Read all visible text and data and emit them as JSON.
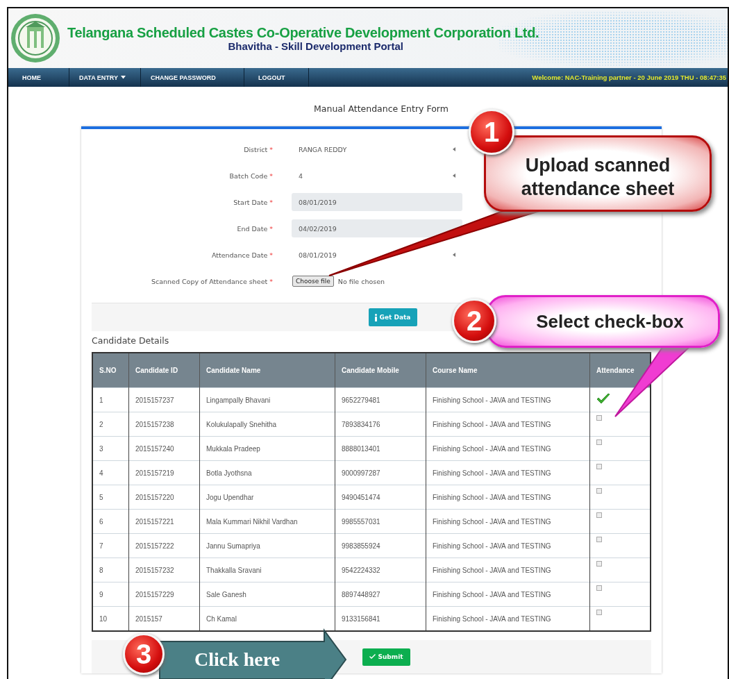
{
  "header": {
    "title": "Telangana Scheduled Castes Co-Operative Development Corporation Ltd.",
    "subtitle": "Bhavitha - Skill Development Portal"
  },
  "nav": {
    "items": [
      {
        "label": "HOME",
        "dropdown": false
      },
      {
        "label": "DATA ENTRY",
        "dropdown": true
      },
      {
        "label": "CHANGE PASSWORD",
        "dropdown": false
      },
      {
        "label": "LOGOUT",
        "dropdown": false
      }
    ],
    "welcome": "Welcome: NAC-Training partner - 20 June 2019 THU - 08:47:35"
  },
  "form": {
    "title": "Manual Attendance Entry Form",
    "fields": [
      {
        "kind": "select",
        "label": "District",
        "required_mark": "*",
        "value": "RANGA REDDY"
      },
      {
        "kind": "select",
        "label": "Batch Code",
        "required_mark": "*",
        "value": "4"
      },
      {
        "kind": "readonly",
        "label": "Start Date",
        "required_mark": "*",
        "value": "08/01/2019"
      },
      {
        "kind": "readonly",
        "label": "End Date",
        "required_mark": "*",
        "value": "04/02/2019"
      },
      {
        "kind": "select",
        "label": "Attendance Date",
        "required_mark": "*",
        "value": "08/01/2019"
      },
      {
        "kind": "file",
        "label": "Scanned Copy of Attendance sheet",
        "required_mark": "*",
        "button": "Choose file",
        "value": "No file chosen"
      }
    ],
    "get_data_button": "Get Data"
  },
  "candidates": {
    "title": "Candidate Details",
    "columns": [
      "S.NO",
      "Candidate ID",
      "Candidate Name",
      "Candidate Mobile",
      "Course Name",
      "Attendance"
    ],
    "rows": [
      {
        "cells": [
          "1",
          "2015157237",
          "Lingampally Bhavani",
          "9652279481",
          "Finishing School - JAVA and TESTING"
        ],
        "checked": true
      },
      {
        "cells": [
          "2",
          "2015157238",
          "Kolukulapally Snehitha",
          "7893834176",
          "Finishing School - JAVA and TESTING"
        ],
        "checked": false
      },
      {
        "cells": [
          "3",
          "2015157240",
          "Mukkala Pradeep",
          "8888013401",
          "Finishing School - JAVA and TESTING"
        ],
        "checked": false
      },
      {
        "cells": [
          "4",
          "2015157219",
          "Botla Jyothsna",
          "9000997287",
          "Finishing School - JAVA and TESTING"
        ],
        "checked": false
      },
      {
        "cells": [
          "5",
          "2015157220",
          "Jogu Upendhar",
          "9490451474",
          "Finishing School - JAVA and TESTING"
        ],
        "checked": false
      },
      {
        "cells": [
          "6",
          "2015157221",
          "Mala Kummari Nikhil Vardhan",
          "9985557031",
          "Finishing School - JAVA and TESTING"
        ],
        "checked": false
      },
      {
        "cells": [
          "7",
          "2015157222",
          "Jannu Sumapriya",
          "9983855924",
          "Finishing School - JAVA and TESTING"
        ],
        "checked": false
      },
      {
        "cells": [
          "8",
          "2015157232",
          "Thakkalla Sravani",
          "9542224332",
          "Finishing School - JAVA and TESTING"
        ],
        "checked": false
      },
      {
        "cells": [
          "9",
          "2015157229",
          "Sale Ganesh",
          "8897448927",
          "Finishing School - JAVA and TESTING"
        ],
        "checked": false
      },
      {
        "cells": [
          "10",
          "2015157",
          "Ch Kamal",
          "9133156841",
          "Finishing School - JAVA and TESTING"
        ],
        "checked": false
      }
    ]
  },
  "submit_button": "Submit",
  "annotations": [
    {
      "kind": "callout-red",
      "number": "1",
      "text": "Upload scanned attendance sheet"
    },
    {
      "kind": "callout-pink",
      "number": "2",
      "text": "Select check-box"
    },
    {
      "kind": "arrow",
      "number": "3",
      "text": "Click here"
    }
  ]
}
